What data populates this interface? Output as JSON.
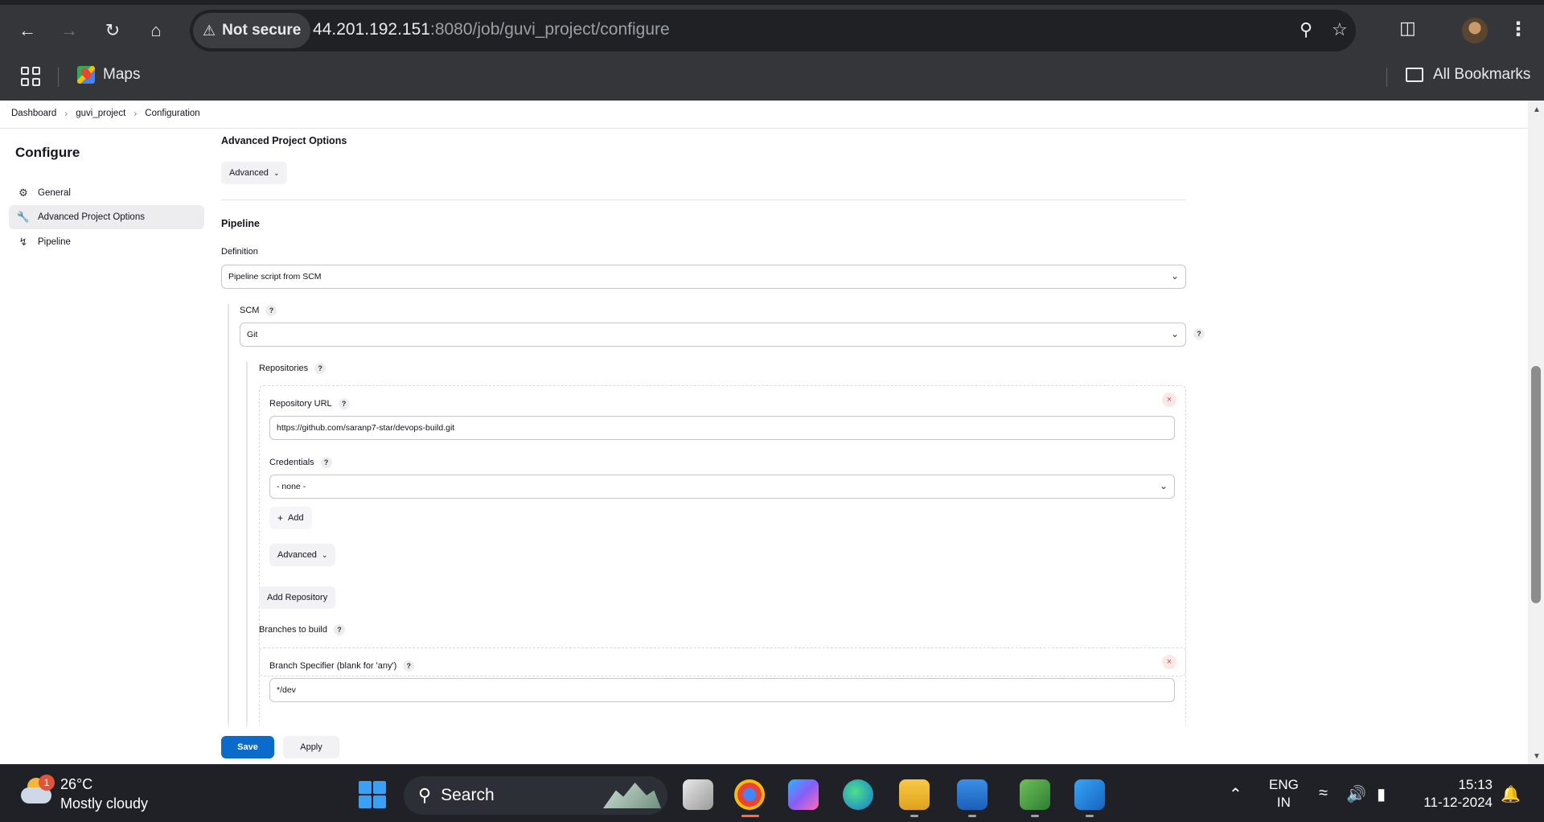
{
  "browser": {
    "security_label": "Not secure",
    "url_host": "44.201.192.151",
    "url_rest": ":8080/job/guvi_project/configure",
    "bookmarks": {
      "maps": "Maps",
      "all": "All Bookmarks"
    }
  },
  "breadcrumb": [
    "Dashboard",
    "guvi_project",
    "Configuration"
  ],
  "sidebar": {
    "title": "Configure",
    "items": [
      {
        "label": "General",
        "icon": "gear-icon"
      },
      {
        "label": "Advanced Project Options",
        "icon": "wrench-icon"
      },
      {
        "label": "Pipeline",
        "icon": "pipeline-icon"
      }
    ]
  },
  "main": {
    "advanced_options_title": "Advanced Project Options",
    "advanced_button": "Advanced",
    "pipeline_title": "Pipeline",
    "definition_label": "Definition",
    "definition_value": "Pipeline script from SCM",
    "scm_label": "SCM",
    "scm_value": "Git",
    "repositories_label": "Repositories",
    "repo_url_label": "Repository URL",
    "repo_url_value": "https://github.com/saranp7-star/devops-build.git",
    "credentials_label": "Credentials",
    "credentials_value": "- none -",
    "add_label": "Add",
    "repo_advanced": "Advanced",
    "add_repository": "Add Repository",
    "branches_label": "Branches to build",
    "branch_specifier_label": "Branch Specifier (blank for 'any')",
    "branch_specifier_value": "*/dev",
    "help_glyph": "?",
    "remove_glyph": "×"
  },
  "actions": {
    "save": "Save",
    "apply": "Apply"
  },
  "taskbar": {
    "weather_temp": "26°C",
    "weather_desc": "Mostly cloudy",
    "weather_badge": "1",
    "search_placeholder": "Search",
    "lang_top": "ENG",
    "lang_bottom": "IN",
    "time": "15:13",
    "date": "11-12-2024"
  },
  "colors": {
    "save_button": "#0b6bcb",
    "chrome_bg": "#35363a",
    "taskbar_bg": "#1f2127"
  }
}
